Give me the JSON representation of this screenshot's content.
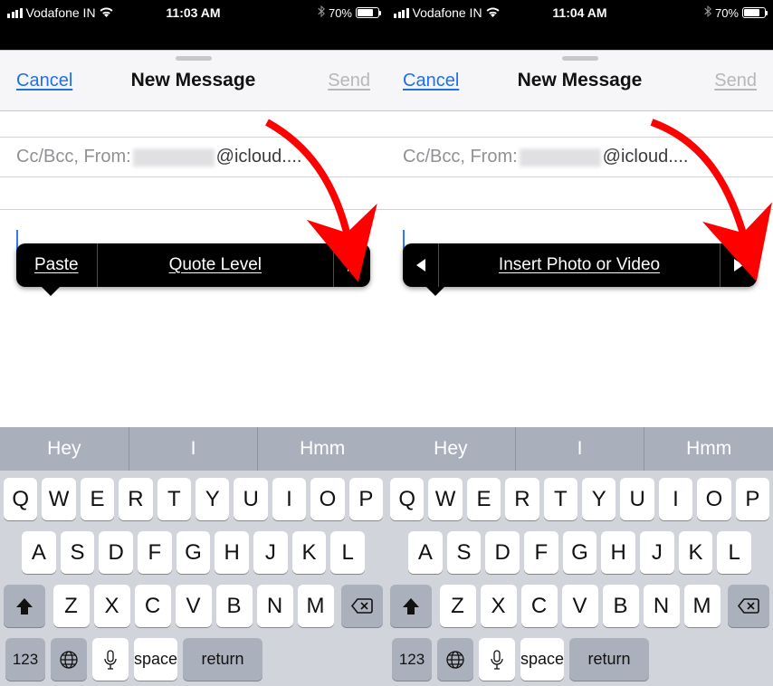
{
  "left": {
    "status": {
      "carrier": "Vodafone IN",
      "time": "11:03 AM",
      "battery_pct": "70%"
    },
    "header": {
      "cancel": "Cancel",
      "title": "New Message",
      "send": "Send"
    },
    "cc_label": "Cc/Bcc, From: ",
    "cc_domain": "@icloud....",
    "ctx": {
      "paste": "Paste",
      "quote": "Quote Level"
    }
  },
  "right": {
    "status": {
      "carrier": "Vodafone IN",
      "time": "11:04 AM",
      "battery_pct": "70%"
    },
    "header": {
      "cancel": "Cancel",
      "title": "New Message",
      "send": "Send"
    },
    "cc_label": "Cc/Bcc, From: ",
    "cc_domain": "@icloud....",
    "ctx": {
      "insert": "Insert Photo or Video"
    }
  },
  "suggest": {
    "a": "Hey",
    "b": "I",
    "c": "Hmm"
  },
  "keys": {
    "r1": [
      "Q",
      "W",
      "E",
      "R",
      "T",
      "Y",
      "U",
      "I",
      "O",
      "P"
    ],
    "r2": [
      "A",
      "S",
      "D",
      "F",
      "G",
      "H",
      "J",
      "K",
      "L"
    ],
    "r3": [
      "Z",
      "X",
      "C",
      "V",
      "B",
      "N",
      "M"
    ],
    "num": "123",
    "space": "space",
    "return": "return"
  }
}
